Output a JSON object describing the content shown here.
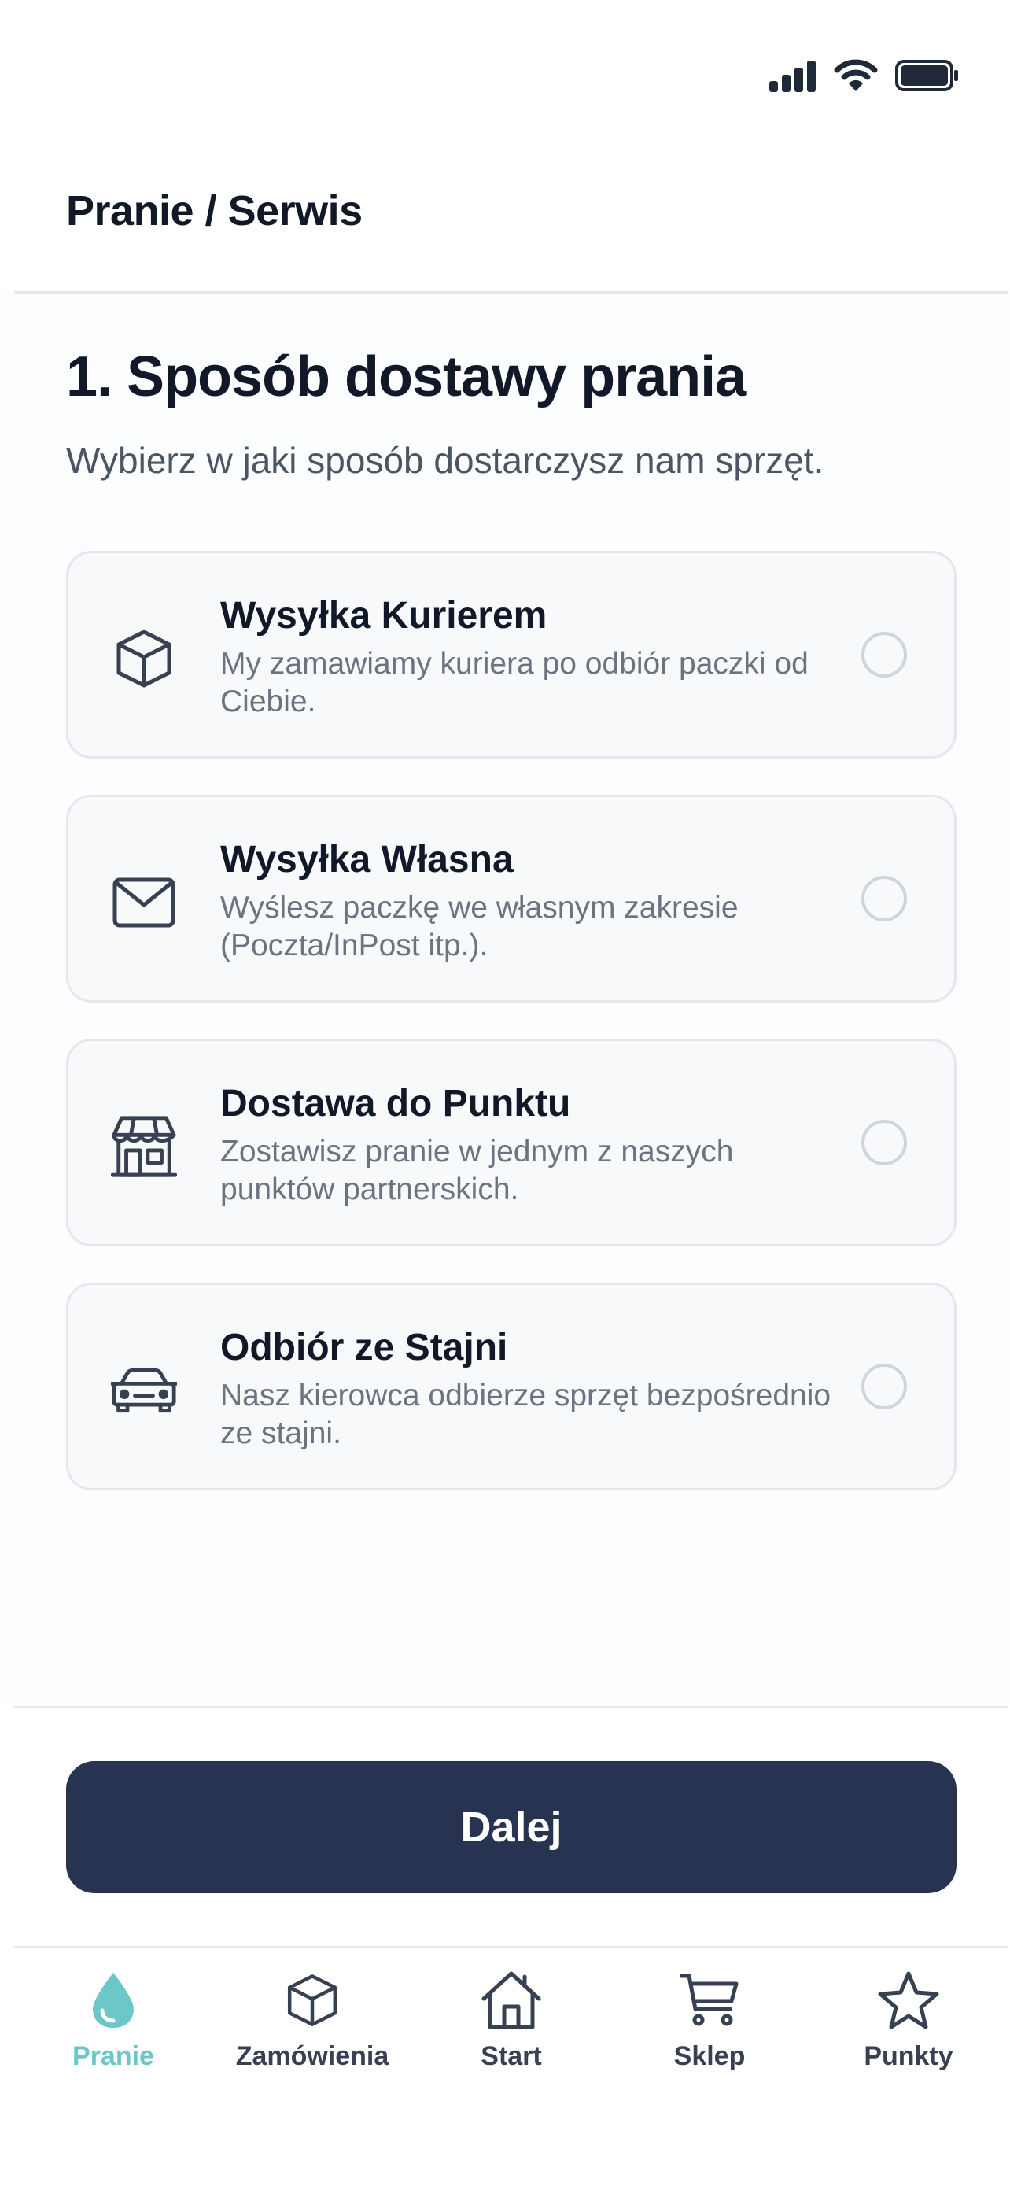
{
  "header": {
    "title": "Pranie / Serwis"
  },
  "step": {
    "title": "1. Sposób dostawy prania",
    "subtitle": "Wybierz w jaki sposób dostarczysz nam sprzęt."
  },
  "options": [
    {
      "title": "Wysyłka Kurierem",
      "description": "My zamawiamy kuriera po odbiór paczki od Ciebie.",
      "icon": "box-icon",
      "selected": false
    },
    {
      "title": "Wysyłka Własna",
      "description": "Wyślesz paczkę we własnym zakresie (Poczta/InPost itp.).",
      "icon": "envelope-icon",
      "selected": false
    },
    {
      "title": "Dostawa do Punktu",
      "description": "Zostawisz pranie w jednym z naszych punktów partnerskich.",
      "icon": "store-icon",
      "selected": false
    },
    {
      "title": "Odbiór ze Stajni",
      "description": "Nasz kierowca odbierze sprzęt bezpośrednio ze stajni.",
      "icon": "car-icon",
      "selected": false
    }
  ],
  "primary_button": {
    "label": "Dalej"
  },
  "bottom_nav": {
    "items": [
      {
        "label": "Pranie",
        "icon": "water-drop-icon",
        "active": true
      },
      {
        "label": "Zamówienia",
        "icon": "box-icon",
        "active": false
      },
      {
        "label": "Start",
        "icon": "home-icon",
        "active": false
      },
      {
        "label": "Sklep",
        "icon": "cart-icon",
        "active": false
      },
      {
        "label": "Punkty",
        "icon": "star-icon",
        "active": false
      }
    ]
  },
  "colors": {
    "primary": "#283352",
    "accent": "#6cc8c8",
    "card_background": "#f8f9fb",
    "border": "#e5e7eb"
  }
}
